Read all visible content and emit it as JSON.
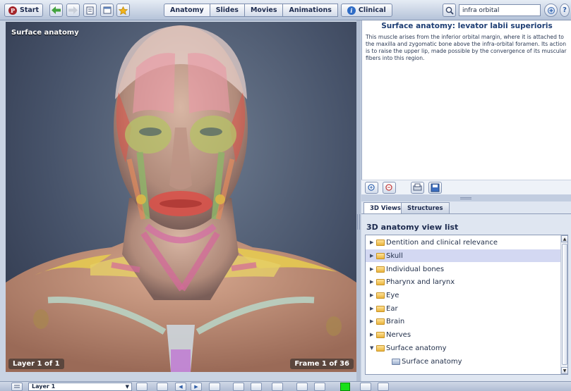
{
  "toolbar": {
    "start_label": "Start",
    "tabs": [
      {
        "label": "Anatomy",
        "active": true
      },
      {
        "label": "Slides",
        "active": false
      },
      {
        "label": "Movies",
        "active": false
      },
      {
        "label": "Animations",
        "active": false
      },
      {
        "label": "Clinical",
        "active": false
      }
    ],
    "search_value": "infra orbital",
    "icons": [
      "start-logo-icon",
      "back-arrow-icon",
      "forward-arrow-icon",
      "page-icon",
      "window-icon",
      "favorites-icon",
      "search-icon",
      "zoom-icon",
      "help-icon"
    ]
  },
  "viewer": {
    "title": "Surface anatomy",
    "layer_indicator": "Layer 1 of 1",
    "frame_indicator": "Frame 1 of 36"
  },
  "description": {
    "title": "Surface anatomy: levator labii superioris",
    "text": "This muscle arises from the inferior orbital margin, where it is attached to the maxilla and zygomatic bone above the infra-orbital foramen. Its action is to raise the upper lip, made possible by the convergence of its muscular fibers into this region."
  },
  "list_panel": {
    "tabs": [
      {
        "label": "3D Views",
        "active": true
      },
      {
        "label": "Structures",
        "active": false
      }
    ],
    "heading": "3D anatomy view list",
    "items": [
      {
        "label": "Dentition and clinical relevance",
        "expanded": false,
        "selected": false
      },
      {
        "label": "Skull",
        "expanded": false,
        "selected": true
      },
      {
        "label": "Individual bones",
        "expanded": false,
        "selected": false
      },
      {
        "label": "Pharynx and larynx",
        "expanded": false,
        "selected": false
      },
      {
        "label": "Eye",
        "expanded": false,
        "selected": false
      },
      {
        "label": "Ear",
        "expanded": false,
        "selected": false
      },
      {
        "label": "Brain",
        "expanded": false,
        "selected": false
      },
      {
        "label": "Nerves",
        "expanded": false,
        "selected": false
      },
      {
        "label": "Surface anatomy",
        "expanded": true,
        "selected": false
      },
      {
        "label": "Surface anatomy",
        "expanded": false,
        "selected": false,
        "child": true
      }
    ]
  },
  "bottom": {
    "layer_select": "Layer 1"
  },
  "colors": {
    "toolbar_top": "#e6ecf5",
    "toolbar_bottom": "#b5c3d9",
    "selected_row": "#d3d8f2",
    "title_blue": "#1e3e74",
    "status_green": "#18e018"
  }
}
